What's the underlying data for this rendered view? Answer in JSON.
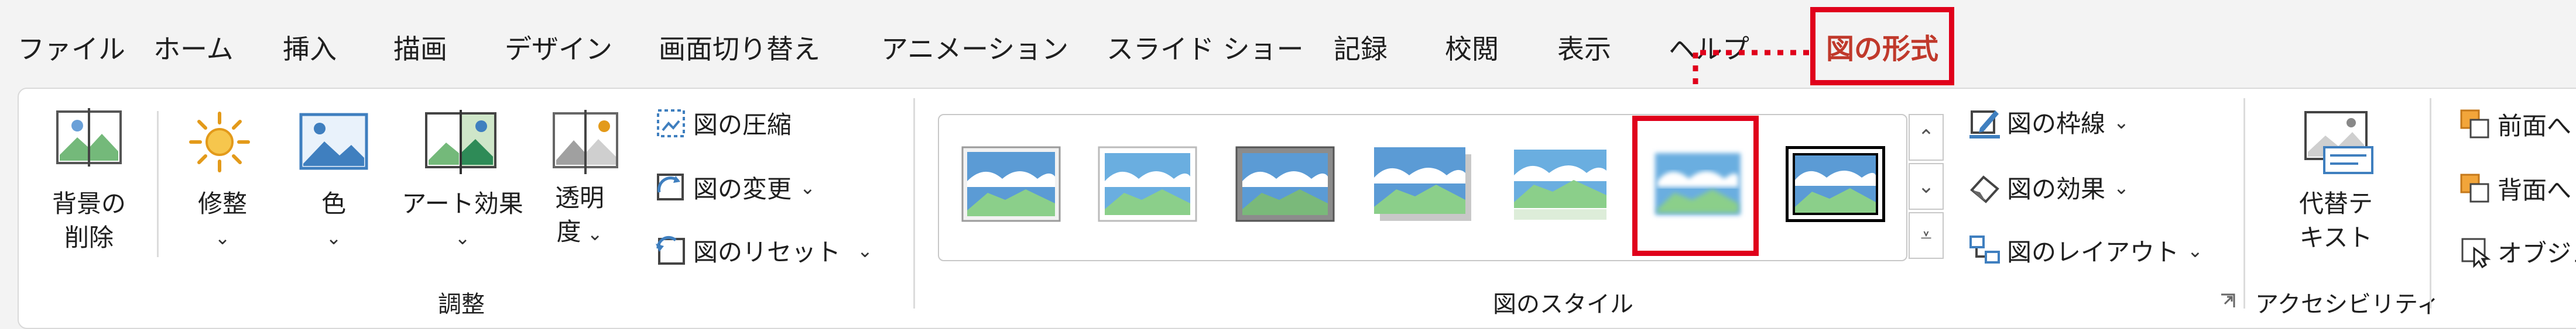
{
  "tabs": [
    "ファイル",
    "ホーム",
    "挿入",
    "描画",
    "デザイン",
    "画面切り替え",
    "アニメーション",
    "スライド ショー",
    "記録",
    "校閲",
    "表示",
    "ヘルプ",
    "図の形式"
  ],
  "adjust": {
    "remove_bg": [
      "背景の",
      "削除"
    ],
    "corrections": "修整",
    "color": "色",
    "artistic": "アート効果",
    "transparency": [
      "透明",
      "度"
    ],
    "compress": "図の圧縮",
    "change": "図の変更",
    "reset": "図のリセット",
    "group_label": "調整"
  },
  "styles": {
    "group_label": "図のスタイル",
    "border": "図の枠線",
    "effects": "図の効果",
    "layout": "図のレイアウト"
  },
  "accessibility": {
    "alt_text": [
      "代替テ",
      "キスト"
    ],
    "group_label": "アクセシビリティ"
  },
  "arrange": {
    "bring_forward": "前面へ",
    "send_backward": "背面へ",
    "selection_pane": "オブジェ"
  },
  "colors": {
    "accent": "#c0392b",
    "highlight": "#e0001b"
  }
}
